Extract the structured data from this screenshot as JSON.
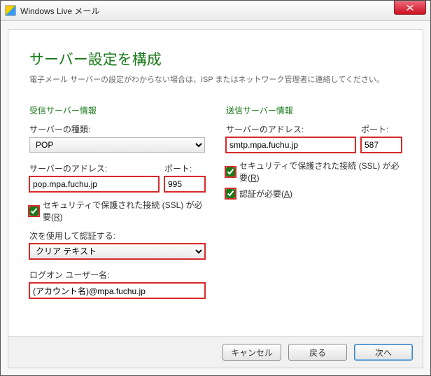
{
  "window": {
    "title": "Windows Live メール"
  },
  "heading": "サーバー設定を構成",
  "subtitle": "電子メール サーバーの設定がわからない場合は、ISP またはネットワーク管理者に連絡してください。",
  "incoming": {
    "section": "受信サーバー情報",
    "type_label": "サーバーの種類:",
    "type_value": "POP",
    "address_label": "サーバーのアドレス:",
    "address_value": "pop.mpa.fuchu.jp",
    "port_label": "ポート:",
    "port_value": "995",
    "ssl_label_pre": "セキュリティで保護された接続 (SSL) が必要(",
    "ssl_key": "R",
    "ssl_label_post": ")",
    "ssl_checked": true,
    "auth_label": "次を使用して認証する:",
    "auth_value": "クリア テキスト",
    "user_label": "ログオン ユーザー名:",
    "user_value": "(アカウント名)@mpa.fuchu.jp"
  },
  "outgoing": {
    "section": "送信サーバー情報",
    "address_label": "サーバーのアドレス:",
    "address_value": "smtp.mpa.fuchu.jp",
    "port_label": "ポート:",
    "port_value": "587",
    "ssl_label_pre": "セキュリティで保護された接続 (SSL) が必要(",
    "ssl_key": "R",
    "ssl_label_post": ")",
    "ssl_checked": true,
    "auth_label_pre": "認証が必要(",
    "auth_key": "A",
    "auth_label_post": ")",
    "auth_checked": true
  },
  "buttons": {
    "cancel": "キャンセル",
    "back": "戻る",
    "next": "次へ"
  }
}
